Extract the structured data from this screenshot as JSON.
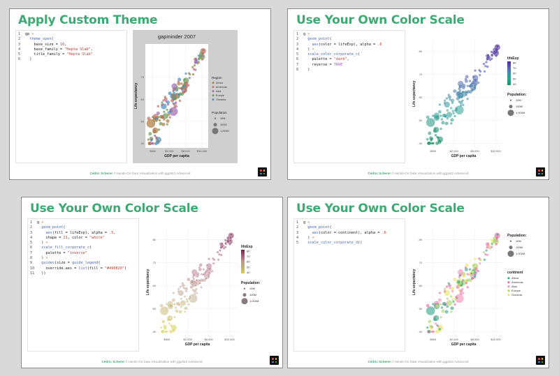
{
  "footer": {
    "author": "Cédric Scherer",
    "separator": " // ",
    "course": "Hands-On Data Visualization with ggplot2 Advanced"
  },
  "slides": [
    {
      "title": "Apply Custom Theme",
      "code": [
        [
          [
            "t",
            "gp "
          ],
          [
            "o",
            "+"
          ]
        ],
        [
          [
            "t",
            "  "
          ],
          [
            "f",
            "theme_open"
          ],
          [
            "t",
            "("
          ]
        ],
        [
          [
            "t",
            "    base_size = "
          ],
          [
            "n",
            "10"
          ],
          [
            "t",
            ","
          ]
        ],
        [
          [
            "t",
            "    base_family = "
          ],
          [
            "s",
            "\"Hepta Slab\""
          ],
          [
            "t",
            ","
          ]
        ],
        [
          [
            "t",
            "    title_family = "
          ],
          [
            "s",
            "\"Hepta Slab\""
          ]
        ],
        [
          [
            "t",
            "  )"
          ]
        ]
      ],
      "chart": {
        "title": "gapminder 2007",
        "xlabel": "GDP per capita",
        "ylabel": "Life expectancy",
        "xticks": [
          "$500",
          "$2,000",
          "$8,000",
          "$32,000"
        ],
        "yticks": [
          "40",
          "50",
          "60",
          "70"
        ],
        "legend1_title": "Region",
        "legend1_items": [
          "Africa",
          "Americas",
          "Asia",
          "Europe",
          "Oceania"
        ],
        "legend1_colors": [
          "#a97c3a",
          "#c96a6a",
          "#9b6bb3",
          "#6a9d55",
          "#4a8dba"
        ],
        "legend2_title": "Population",
        "legend2_items": [
          "10M",
          "100M",
          "1,000M"
        ],
        "scheme": "theme"
      }
    },
    {
      "title": "Use Your Own Color Scale",
      "code": [
        [
          [
            "t",
            "g "
          ],
          [
            "o",
            "+"
          ]
        ],
        [
          [
            "t",
            "  "
          ],
          [
            "f",
            "geom_point"
          ],
          [
            "t",
            "("
          ]
        ],
        [
          [
            "t",
            "    "
          ],
          [
            "f",
            "aes"
          ],
          [
            "t",
            "(color = lifeExp), alpha = "
          ],
          [
            "n",
            ".6"
          ]
        ],
        [
          [
            "t",
            "  ) "
          ],
          [
            "o",
            "+"
          ]
        ],
        [
          [
            "t",
            "  "
          ],
          [
            "f",
            "scale_color_corporate_c"
          ],
          [
            "t",
            "("
          ]
        ],
        [
          [
            "t",
            "    palette = "
          ],
          [
            "s",
            "\"dark\""
          ],
          [
            "t",
            ","
          ]
        ],
        [
          [
            "t",
            "    reverse = "
          ],
          [
            "k",
            "TRUE"
          ]
        ],
        [
          [
            "t",
            "  )"
          ]
        ]
      ],
      "chart": {
        "title": "",
        "xlabel": "GDP per capita",
        "ylabel": "Life expectancy",
        "xticks": [
          "$500",
          "$2,000",
          "$8,000",
          "$32,000"
        ],
        "yticks": [
          "40",
          "50",
          "60",
          "70",
          "80"
        ],
        "legend1_title": "lifeExp",
        "legend1_items": [
          "80",
          "70",
          "60",
          "50",
          "40"
        ],
        "legend1_colors": [
          "#4b2a9a",
          "#5a5fb0",
          "#3f8fa8",
          "#2fa58a",
          "#1d8f6a"
        ],
        "legend2_title": "Population:",
        "legend2_items": [
          "10M",
          "100M",
          "1,000M"
        ],
        "scheme": "dark"
      }
    },
    {
      "title": "Use Your Own Color Scale",
      "code": [
        [
          [
            "t",
            "g "
          ],
          [
            "o",
            "+"
          ]
        ],
        [
          [
            "t",
            "  "
          ],
          [
            "f",
            "geom_point"
          ],
          [
            "t",
            "("
          ]
        ],
        [
          [
            "t",
            "    "
          ],
          [
            "f",
            "aes"
          ],
          [
            "t",
            "(fill = lifeExp), alpha = "
          ],
          [
            "n",
            ".5"
          ],
          [
            "t",
            ","
          ]
        ],
        [
          [
            "t",
            "    shape = "
          ],
          [
            "n",
            "21"
          ],
          [
            "t",
            ", color = "
          ],
          [
            "s",
            "\"white\""
          ]
        ],
        [
          [
            "t",
            "  ) "
          ],
          [
            "o",
            "+"
          ]
        ],
        [
          [
            "t",
            "  "
          ],
          [
            "f",
            "scale_fill_corporate_c"
          ],
          [
            "t",
            "("
          ]
        ],
        [
          [
            "t",
            "    palette = "
          ],
          [
            "s",
            "\"inverse\""
          ]
        ],
        [
          [
            "t",
            "  ) "
          ],
          [
            "o",
            "+"
          ]
        ],
        [
          [
            "t",
            "  "
          ],
          [
            "f",
            "guides"
          ],
          [
            "t",
            "(size = "
          ],
          [
            "f",
            "guide_legend"
          ],
          [
            "t",
            "("
          ]
        ],
        [
          [
            "t",
            "    override.aes = "
          ],
          [
            "f",
            "list"
          ],
          [
            "t",
            "(fill = "
          ],
          [
            "s",
            "\"#490820\""
          ],
          [
            "t",
            ")"
          ]
        ],
        [
          [
            "t",
            "  ))"
          ]
        ]
      ],
      "chart": {
        "title": "",
        "xlabel": "GDP per capita",
        "ylabel": "Life expectancy",
        "xticks": [
          "$500",
          "$2,000",
          "$8,000",
          "$32,000"
        ],
        "yticks": [
          "40",
          "50",
          "60",
          "70",
          "80"
        ],
        "legend1_title": "lifeExp",
        "legend1_items": [
          "80",
          "70",
          "60",
          "50",
          "40"
        ],
        "legend1_colors": [
          "#7a1f4a",
          "#a8587a",
          "#c39a86",
          "#bfb36a",
          "#d6d24a"
        ],
        "legend2_title": "Population:",
        "legend2_items": [
          "10M",
          "100M",
          "1,000M"
        ],
        "scheme": "inverse"
      }
    },
    {
      "title": "Use Your Own Color Scale",
      "code": [
        [
          [
            "t",
            "g "
          ],
          [
            "o",
            "+"
          ]
        ],
        [
          [
            "t",
            "  "
          ],
          [
            "f",
            "geom_point"
          ],
          [
            "t",
            "("
          ]
        ],
        [
          [
            "t",
            "    "
          ],
          [
            "f",
            "aes"
          ],
          [
            "t",
            "(color = continent), alpha = "
          ],
          [
            "n",
            ".6"
          ]
        ],
        [
          [
            "t",
            "  ) "
          ],
          [
            "o",
            "+"
          ]
        ],
        [
          [
            "t",
            "  "
          ],
          [
            "f",
            "scale_color_corporate_d"
          ],
          [
            "t",
            "()"
          ]
        ]
      ],
      "chart": {
        "title": "",
        "xlabel": "GDP per capita",
        "ylabel": "Life expectancy",
        "xticks": [
          "$500",
          "$2,000",
          "$8,000",
          "$32,000"
        ],
        "yticks": [
          "40",
          "50",
          "60",
          "70",
          "80"
        ],
        "legend1_title": "Population:",
        "legend1_items": [
          "10M",
          "100M",
          "1,000M"
        ],
        "legend1_colors": [],
        "legend2_title": "continent",
        "legend2_items": [
          "Africa",
          "Americas",
          "Asia",
          "Europe",
          "Oceania"
        ],
        "legend2_colors": [
          "#2fa58a",
          "#e36aa4",
          "#f18bb8",
          "#a9d35e",
          "#e9e35a"
        ],
        "scheme": "discrete"
      }
    }
  ],
  "chart_data": [
    {
      "type": "scatter",
      "title": "gapminder 2007",
      "xlabel": "GDP per capita",
      "ylabel": "Life expectancy",
      "x_scale": "log",
      "xlim": [
        300,
        50000
      ],
      "ylim": [
        38,
        85
      ]
    },
    {
      "type": "scatter",
      "title": "",
      "xlabel": "GDP per capita",
      "ylabel": "Life expectancy",
      "x_scale": "log",
      "xlim": [
        300,
        50000
      ],
      "ylim": [
        38,
        85
      ]
    },
    {
      "type": "scatter",
      "title": "",
      "xlabel": "GDP per capita",
      "ylabel": "Life expectancy",
      "x_scale": "log",
      "xlim": [
        300,
        50000
      ],
      "ylim": [
        38,
        85
      ]
    },
    {
      "type": "scatter",
      "title": "",
      "xlabel": "GDP per capita",
      "ylabel": "Life expectancy",
      "x_scale": "log",
      "xlim": [
        300,
        50000
      ],
      "ylim": [
        38,
        85
      ]
    }
  ]
}
